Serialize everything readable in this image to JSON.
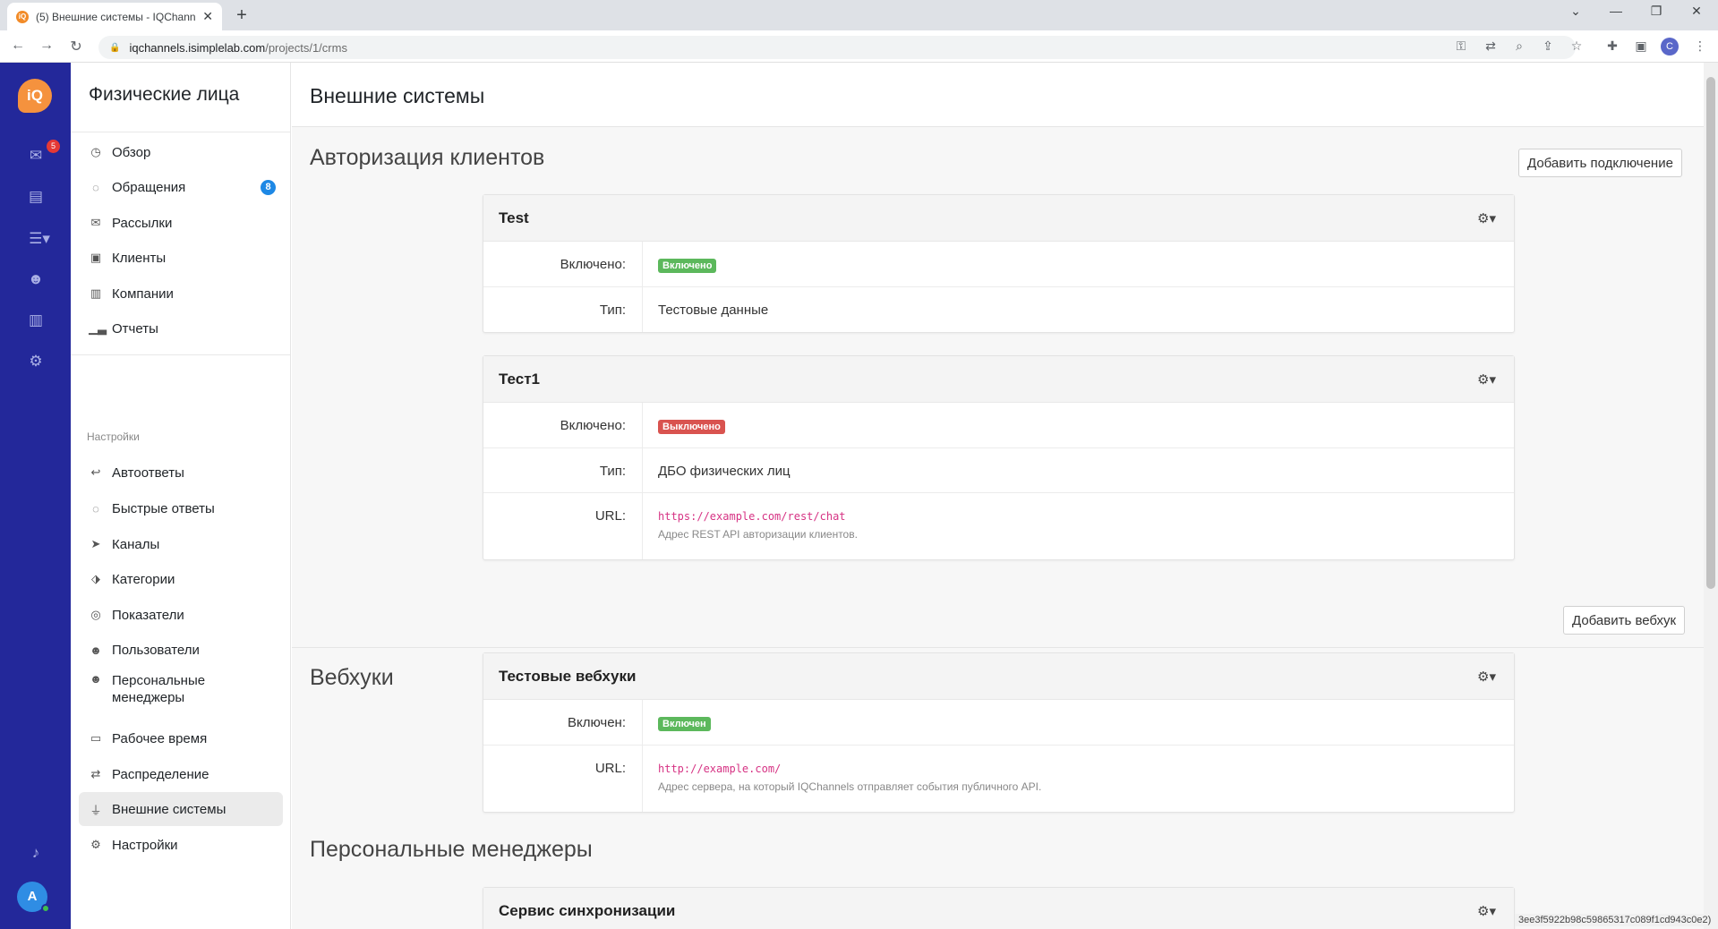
{
  "browser": {
    "tab_title": "(5) Внешние системы - IQChann",
    "tab_favicon": "iQ",
    "url_host": "iqchannels.isimplelab.com",
    "url_path": "/projects/1/crms",
    "profile_initial": "C",
    "status_text": "3ee3f5922b98c59865317c089f1cd943c0e2)"
  },
  "rail": {
    "logo": "iQ",
    "inbox_badge": "5",
    "avatar_initial": "A",
    "icons": [
      "inbox-icon",
      "contacts-icon",
      "list-icon",
      "users-icon",
      "chart-icon",
      "settings-icon",
      "bell-icon"
    ]
  },
  "sidebar": {
    "title": "Физические лица",
    "items": [
      {
        "label": "Обзор",
        "icon": "dashboard-icon"
      },
      {
        "label": "Обращения",
        "icon": "chat-icon",
        "badge": "8"
      },
      {
        "label": "Рассылки",
        "icon": "mail-icon"
      },
      {
        "label": "Клиенты",
        "icon": "contact-icon"
      },
      {
        "label": "Компании",
        "icon": "building-icon"
      },
      {
        "label": "Отчеты",
        "icon": "chart-icon"
      }
    ],
    "settings_section": "Настройки",
    "settings_items": [
      {
        "label": "Автоответы",
        "icon": "reply-icon"
      },
      {
        "label": "Быстрые ответы",
        "icon": "message-icon"
      },
      {
        "label": "Каналы",
        "icon": "send-icon"
      },
      {
        "label": "Категории",
        "icon": "tag-icon"
      },
      {
        "label": "Показатели",
        "icon": "target-icon"
      },
      {
        "label": "Пользователи",
        "icon": "users-icon"
      },
      {
        "label": "Персональные менеджеры",
        "icon": "users-icon"
      },
      {
        "label": "Рабочее время",
        "icon": "calendar-icon"
      },
      {
        "label": "Распределение",
        "icon": "swap-icon"
      },
      {
        "label": "Внешние системы",
        "icon": "plug-icon"
      },
      {
        "label": "Настройки",
        "icon": "gear-icon"
      }
    ]
  },
  "main": {
    "title": "Внешние системы",
    "auth": {
      "title": "Авторизация клиентов",
      "add_button": "Добавить подключение",
      "cards": [
        {
          "name": "Test",
          "enabled_label": "Включено:",
          "enabled_value": "Включено",
          "type_label": "Тип:",
          "type_value": "Тестовые данные"
        },
        {
          "name": "Тест1",
          "enabled_label": "Включено:",
          "enabled_value": "Выключено",
          "type_label": "Тип:",
          "type_value": "ДБО физических лиц",
          "url_label": "URL:",
          "url_value": "https://example.com/rest/chat",
          "url_help": "Адрес REST API авторизации клиентов."
        }
      ]
    },
    "webhooks": {
      "title": "Вебхуки",
      "add_button": "Добавить вебхук",
      "card": {
        "name": "Тестовые вебхуки",
        "enabled_label": "Включен:",
        "enabled_value": "Включен",
        "url_label": "URL:",
        "url_value": "http://example.com/",
        "url_help": "Адрес сервера, на который IQChannels отправляет события публичного API."
      }
    },
    "managers": {
      "title": "Персональные менеджеры",
      "card": {
        "name": "Сервис синхронизации"
      }
    }
  },
  "colors": {
    "rail": "#23289a",
    "accent": "#f5923e",
    "badge_on": "#5cb85c",
    "badge_off": "#d9534f",
    "count_badge": "#1e88e5"
  }
}
